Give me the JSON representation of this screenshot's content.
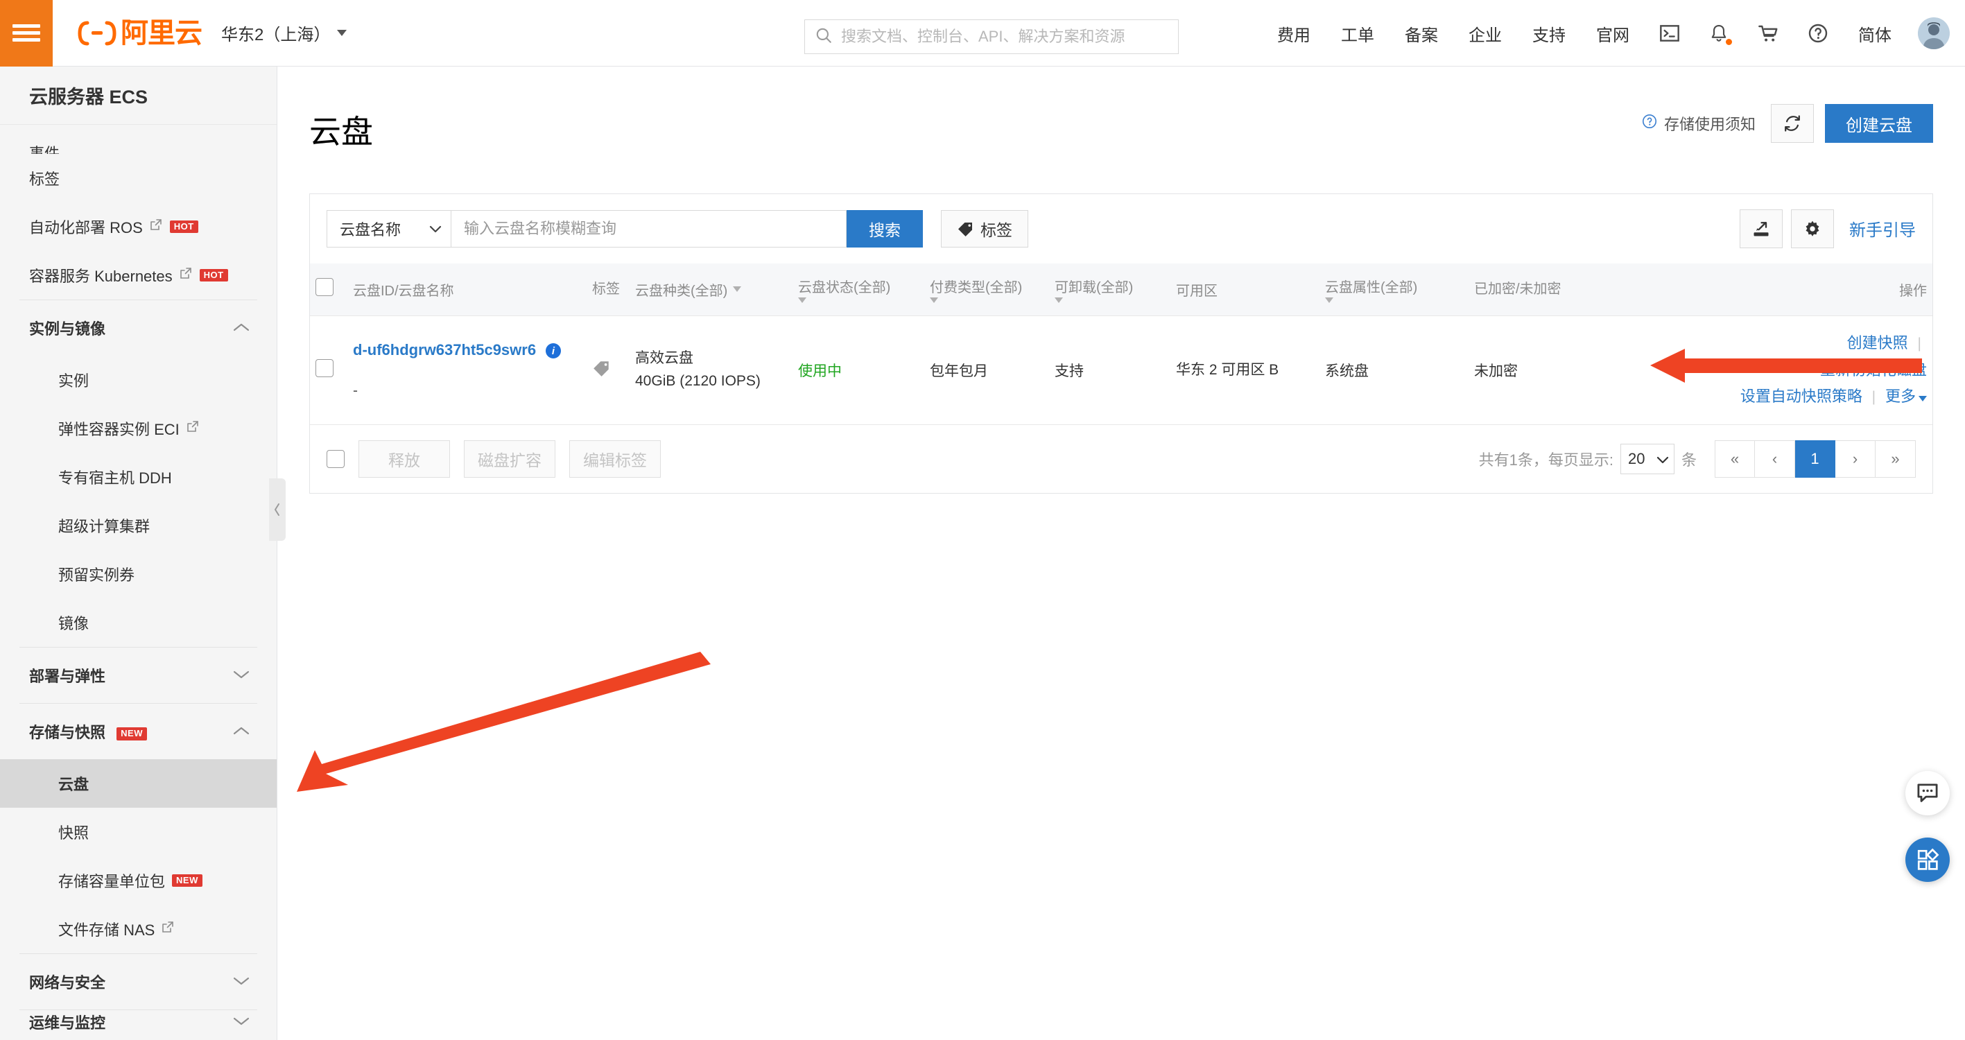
{
  "header": {
    "menu_icon": "hamburger-icon",
    "brand": "阿里云",
    "region": "华东2（上海）",
    "search_placeholder": "搜索文档、控制台、API、解决方案和资源",
    "search_value": "",
    "nav_links": [
      "费用",
      "工单",
      "备案",
      "企业",
      "支持",
      "官网"
    ],
    "icons": [
      "terminal-icon",
      "bell-icon",
      "cart-icon",
      "help-icon"
    ],
    "language": "简体",
    "avatar": "user-avatar"
  },
  "sidebar": {
    "title": "云服务器 ECS",
    "items": [
      {
        "label": "事件",
        "type": "item",
        "clipped": true
      },
      {
        "label": "标签",
        "type": "item"
      },
      {
        "label": "自动化部署 ROS",
        "type": "item",
        "external": true,
        "badge": "HOT"
      },
      {
        "label": "容器服务 Kubernetes",
        "type": "item",
        "external": true,
        "badge": "HOT"
      },
      {
        "label": "实例与镜像",
        "type": "group",
        "expanded": true
      },
      {
        "label": "实例",
        "type": "sub"
      },
      {
        "label": "弹性容器实例 ECI",
        "type": "sub",
        "external": true
      },
      {
        "label": "专有宿主机 DDH",
        "type": "sub"
      },
      {
        "label": "超级计算集群",
        "type": "sub"
      },
      {
        "label": "预留实例券",
        "type": "sub"
      },
      {
        "label": "镜像",
        "type": "sub"
      },
      {
        "label": "部署与弹性",
        "type": "group",
        "expanded": false
      },
      {
        "label": "存储与快照",
        "type": "group",
        "expanded": true,
        "badge": "NEW"
      },
      {
        "label": "云盘",
        "type": "sub",
        "active": true
      },
      {
        "label": "快照",
        "type": "sub"
      },
      {
        "label": "存储容量单位包",
        "type": "sub",
        "badge": "NEW"
      },
      {
        "label": "文件存储 NAS",
        "type": "sub",
        "external": true
      },
      {
        "label": "网络与安全",
        "type": "group",
        "expanded": false
      },
      {
        "label": "运维与监控",
        "type": "group",
        "expanded": false,
        "clipped": true
      }
    ],
    "collapse_handle": "sidebar-collapse-handle"
  },
  "page": {
    "title": "云盘",
    "help_link": "存储使用须知",
    "refresh_icon": "refresh-icon",
    "create_button": "创建云盘"
  },
  "filter": {
    "select_value": "云盘名称",
    "input_placeholder": "输入云盘名称模糊查询",
    "input_value": "",
    "search_button": "搜索",
    "tag_button": "标签",
    "export_icon": "export-icon",
    "settings_icon": "gear-icon",
    "guide_link": "新手引导"
  },
  "table": {
    "columns": [
      {
        "key": "checkbox",
        "label": "",
        "filter": false
      },
      {
        "key": "disk_id",
        "label": "云盘ID/云盘名称",
        "filter": false
      },
      {
        "key": "tag",
        "label": "标签",
        "filter": false
      },
      {
        "key": "category",
        "label": "云盘种类(全部)",
        "filter": true
      },
      {
        "key": "status",
        "label": "云盘状态(全部)",
        "filter": true
      },
      {
        "key": "pay_type",
        "label": "付费类型(全部)",
        "filter": true
      },
      {
        "key": "detachable",
        "label": "可卸载(全部)",
        "filter": true
      },
      {
        "key": "zone",
        "label": "可用区",
        "filter": false
      },
      {
        "key": "attribute",
        "label": "云盘属性(全部)",
        "filter": true
      },
      {
        "key": "encrypted",
        "label": "已加密/未加密",
        "filter": false
      },
      {
        "key": "ops",
        "label": "操作",
        "filter": false
      }
    ],
    "rows": [
      {
        "disk_id": "d-uf6hdgrw637ht5c9swr6",
        "disk_name": "-",
        "info_icon": "info-icon",
        "tag_icon": "tag-icon",
        "category": "高效云盘",
        "size": "40GiB (2120 IOPS)",
        "status": "使用中",
        "status_color": "#21a621",
        "pay_type": "包年包月",
        "detachable": "支持",
        "zone": "华东 2 可用区 B",
        "attribute": "系统盘",
        "encrypted": "未加密",
        "ops": [
          "创建快照",
          "重新初始化磁盘",
          "设置自动快照策略",
          "更多"
        ]
      }
    ]
  },
  "footer": {
    "bulk_actions": [
      "释放",
      "磁盘扩容",
      "编辑标签"
    ],
    "total_text": "共有1条，每页显示:",
    "page_size": "20",
    "unit": "条",
    "pager": [
      "«",
      "‹",
      "1",
      "›",
      "»"
    ],
    "active_page": "1"
  },
  "floating": {
    "chat_icon": "chat-bubble-icon",
    "apps_icon": "apps-grid-icon"
  },
  "colors": {
    "brand_orange": "#f07818",
    "primary_blue": "#2a7ac8",
    "link_blue": "#2a7ac8",
    "success_green": "#21a621",
    "badge_red": "#e03a32",
    "annotation_red": "#ee4323"
  },
  "annotations": [
    {
      "name": "arrow-to-reinitialize-disk",
      "color": "#ee4323"
    },
    {
      "name": "arrow-to-cloud-disk-menu",
      "color": "#ee4323"
    }
  ]
}
